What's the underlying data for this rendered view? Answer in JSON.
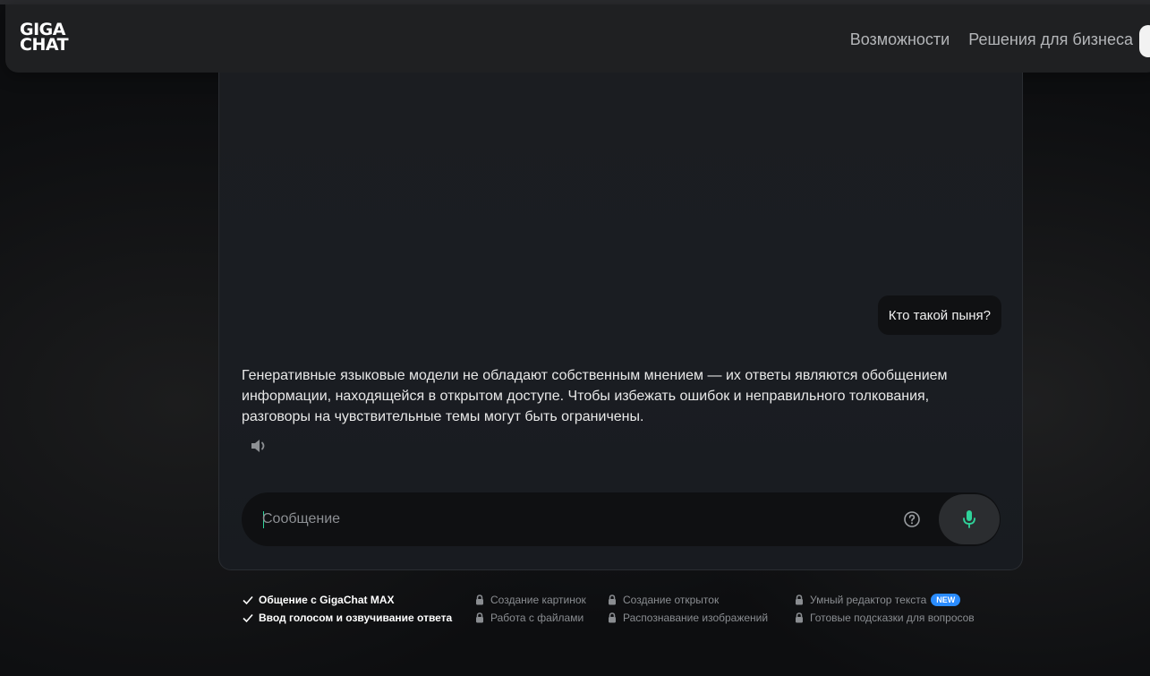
{
  "header": {
    "logo_line1": "GIGA",
    "logo_line2": "CHAT",
    "nav": [
      {
        "label": "Возможности"
      },
      {
        "label": "Решения для бизнеса"
      }
    ]
  },
  "chat": {
    "user_message": "Кто такой пыня?",
    "bot_message": "Генеративные языковые модели не обладают собственным мнением — их ответы являются обобщением информации, находящейся в открытом доступе. Чтобы избежать ошибок и неправильного толкования, разговоры на чувствительные темы могут быть ограничены."
  },
  "input": {
    "placeholder": "Сообщение",
    "value": ""
  },
  "features": {
    "enabled": [
      {
        "label": "Общение с GigaChat MAX"
      },
      {
        "label": "Ввод голосом и озвучивание ответа"
      }
    ],
    "locked_col1": [
      {
        "label": "Создание картинок"
      },
      {
        "label": "Работа с файлами"
      }
    ],
    "locked_col2": [
      {
        "label": "Создание открыток"
      },
      {
        "label": "Распознавание изображений"
      }
    ],
    "locked_col3": [
      {
        "label": "Умный редактор текста",
        "badge": "NEW"
      },
      {
        "label": "Готовые подсказки для вопросов"
      }
    ]
  },
  "colors": {
    "accent_green": "#2fd39a",
    "badge_blue": "#2a8cff",
    "background": "#0d0e10"
  },
  "icons": {
    "speaker": "speaker-icon",
    "help": "question-circle-icon",
    "mic": "microphone-icon",
    "check": "check-icon",
    "lock": "lock-icon"
  }
}
